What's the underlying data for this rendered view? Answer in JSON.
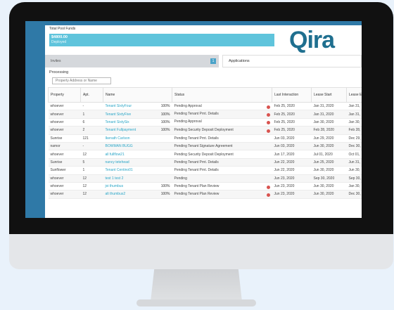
{
  "funds": {
    "label": "Total Pool Funds",
    "amount": "$4800.00",
    "status": "Deployed"
  },
  "logo": {
    "text": "Qira"
  },
  "tabs": {
    "invites": "Invites",
    "invites_count": "1",
    "applications": "Applications"
  },
  "section": {
    "title": "Processing",
    "search_placeholder": "Property Address or Name"
  },
  "table": {
    "headers": [
      "Property",
      "Apt.",
      "Name",
      "Status",
      "Last Interaction",
      "Lease Start",
      "Lease End"
    ],
    "rows": [
      {
        "property": "whoever",
        "apt": "-",
        "name": "Tenant SixtyFour",
        "pct": "100%",
        "status": "Pending Approval",
        "alert": true,
        "last": "Feb 25, 2020",
        "start": "Jan 31, 2020",
        "end": "Jan 31,"
      },
      {
        "property": "whoever",
        "apt": "1",
        "name": "Tenant SixtyFive",
        "pct": "100%",
        "status": "Pending Tenant Prnt. Details",
        "alert": true,
        "last": "Feb 25, 2020",
        "start": "Jan 31, 2020",
        "end": "Jan 31,"
      },
      {
        "property": "whoever",
        "apt": "6",
        "name": "Tenant SixtySix",
        "pct": "100%",
        "status": "Pending Approval",
        "alert": true,
        "last": "Feb 25, 2020",
        "start": "Jan 30, 2020",
        "end": "Jan 30,"
      },
      {
        "property": "whoever",
        "apt": "2",
        "name": "Tenant Fullpayment",
        "pct": "100%",
        "status": "Pending Security Deposit Deployment",
        "alert": true,
        "last": "Feb 25, 2020",
        "start": "Feb 28, 2020",
        "end": "Feb 28,"
      },
      {
        "property": "Sunrise",
        "apt": "121",
        "name": "Ikenath Carlson",
        "pct": "",
        "status": "Pending Tenant Prnt. Details",
        "alert": false,
        "last": "Jun 03, 2020",
        "start": "Jun 29, 2020",
        "end": "Dec 29,"
      },
      {
        "property": "namor",
        "apt": "-",
        "name": "BOWMAN BUGG",
        "pct": "",
        "status": "Pending Tenant Signature Agreement",
        "alert": false,
        "last": "Jun 03, 2020",
        "start": "Jun 30, 2020",
        "end": "Dec 30,"
      },
      {
        "property": "whoever",
        "apt": "12",
        "name": "all fullflow21",
        "pct": "",
        "status": "Pending Security Deposit Deployment",
        "alert": false,
        "last": "Jun 17, 2020",
        "start": "Jul 01, 2020",
        "end": "Oct 01,"
      },
      {
        "property": "Sunrise",
        "apt": "5",
        "name": "nancy tetehead",
        "pct": "",
        "status": "Pending Tenant Prnt. Details",
        "alert": false,
        "last": "Jun 22, 2020",
        "start": "Jun 25, 2020",
        "end": "Jun 31,"
      },
      {
        "property": "Sunflower",
        "apt": "1",
        "name": "Tenant Centino01",
        "pct": "",
        "status": "Pending Tenant Prnt. Details",
        "alert": false,
        "last": "Jun 22, 2020",
        "start": "Jun 30, 2020",
        "end": "Jun 30,"
      },
      {
        "property": "whoever",
        "apt": "12",
        "name": "test 1 test 2",
        "pct": "",
        "status": "Pending",
        "alert": false,
        "last": "Jun 23, 2020",
        "start": "Sep 30, 2020",
        "end": "Sep 30,"
      },
      {
        "property": "whoever",
        "apt": "12",
        "name": "joi thumbus",
        "pct": "100%",
        "status": "Pending Tenant Plan Review",
        "alert": true,
        "last": "Jun 23, 2020",
        "start": "Jun 30, 2020",
        "end": "Jan 30,"
      },
      {
        "property": "whoever",
        "apt": "12",
        "name": "alt thumbus2",
        "pct": "100%",
        "status": "Pending Tenant Plan Review",
        "alert": true,
        "last": "Jun 23, 2020",
        "start": "Jun 30, 2020",
        "end": "Dec 30,"
      }
    ]
  },
  "colors": {
    "accent": "#2aa6c7",
    "funds_bar": "#5fc4dc",
    "logo": "#1f6f8f",
    "screen_bg": "#2f79a7"
  }
}
